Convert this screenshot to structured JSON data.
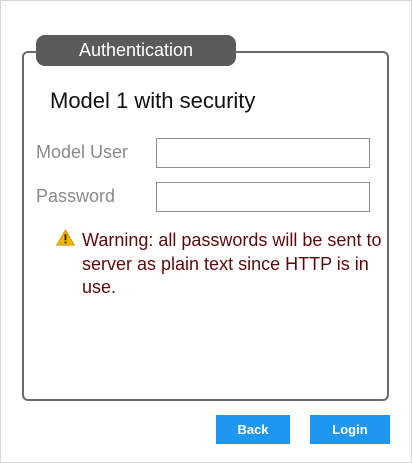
{
  "panel": {
    "tab_label": "Authentication",
    "heading": "Model 1 with security"
  },
  "fields": {
    "user": {
      "label": "Model User",
      "value": ""
    },
    "password": {
      "label": "Password",
      "value": ""
    }
  },
  "warning": {
    "icon": "warning-triangle-icon",
    "text": "Warning: all passwords will be sent to server as plain text since HTTP is in use."
  },
  "buttons": {
    "back_label": "Back",
    "login_label": "Login"
  },
  "colors": {
    "button_bg": "#1e97f3",
    "tab_bg": "#5b5b5b",
    "warning_text": "#5a0a0a",
    "warning_icon": "#f2b400"
  }
}
